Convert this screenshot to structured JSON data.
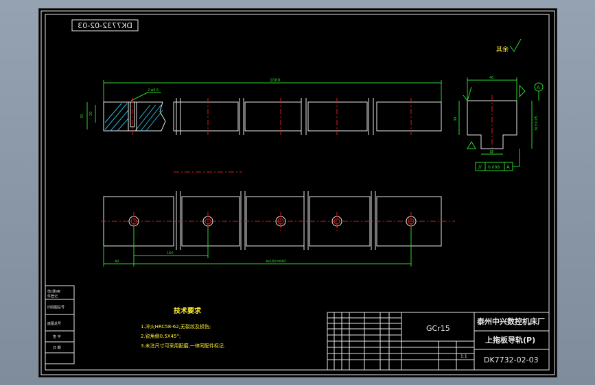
{
  "drawing": {
    "drawing_no_mirrored": "DK7732-02-03",
    "roughness_note": "其余",
    "tech_requirements": {
      "title": "技术要求",
      "items": [
        "1.淬火HRC58-62,无裂纹及损伤;",
        "2.锐角倒0.5X45°;",
        "3.未注尺寸可采用配磨,一律同配件标记."
      ]
    },
    "title_block": {
      "material": "GCr15",
      "company": "泰州中兴数控机床厂",
      "part_name": "上拖板导轨(P)",
      "drawing_no": "DK7732-02-03",
      "scale": "1:1"
    },
    "left_column_labels": [
      "借(通)用",
      "件登记",
      "旧底图总号",
      "底图总号",
      "签 字",
      "日 期"
    ],
    "datum_label": "A",
    "tolerance_value": "0.008"
  },
  "colors": {
    "background": "#000000",
    "outline": "#e8e8e8",
    "dimension": "#2bd92b",
    "centerline": "#e01a1a",
    "hatch": "#2ab7d6",
    "tech_text": "#ffee33"
  }
}
